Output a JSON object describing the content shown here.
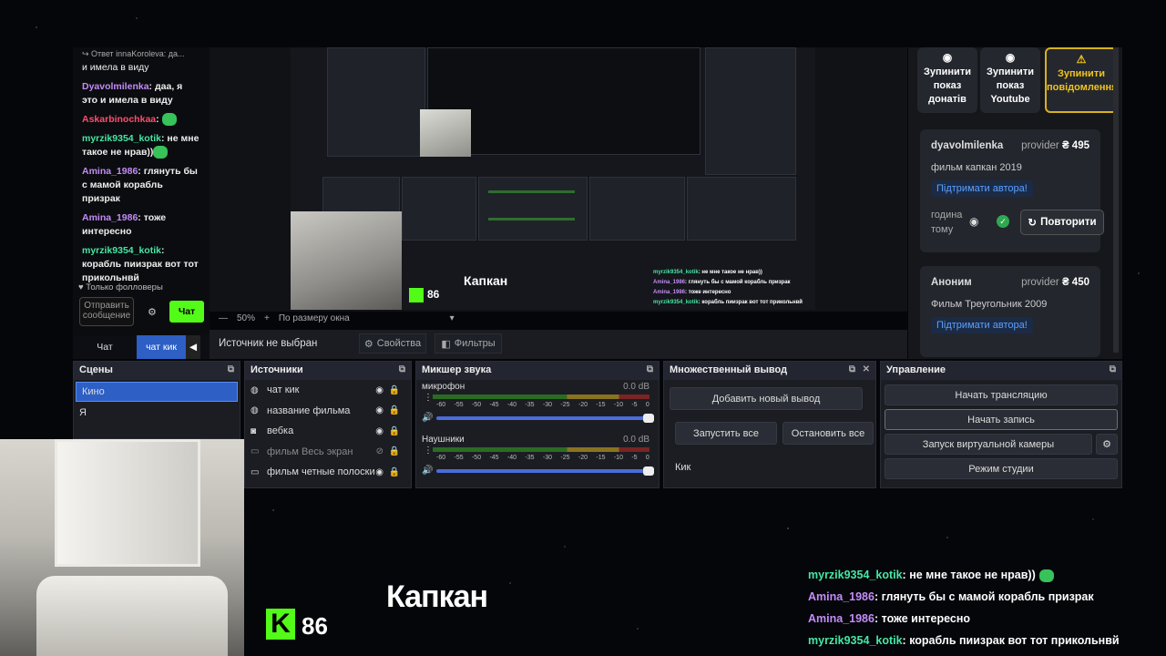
{
  "chat": {
    "reply_text": "Ответ innaKoroleva: да...",
    "reply_prev_text": "и имела в виду",
    "messages": [
      {
        "user": "Dyavolmilenka",
        "text": "даа, я это и имела в виду",
        "color": "#c38cf7"
      },
      {
        "user": "Askarbinochkaa",
        "text": "",
        "color": "#ff4d6d"
      },
      {
        "user": "myrzik9354_kotik",
        "text": "не мне такое не нрав))",
        "color": "#46e6a5"
      },
      {
        "user": "Amina_1986",
        "text": "глянуть бы с мамой корабль призрак",
        "color": "#c38cf7"
      },
      {
        "user": "Amina_1986",
        "text": "тоже интересно",
        "color": "#c38cf7"
      },
      {
        "user": "myrzik9354_kotik",
        "text": "корабль пиизрак вот тот прикольнвй",
        "color": "#46e6a5"
      }
    ],
    "followers_only": "Только фолловеры",
    "input_placeholder": "Отправить сообщение",
    "send_label": "Чат"
  },
  "left_tabs": {
    "chat": "Чат",
    "kick": "чат кик"
  },
  "preview": {
    "zoom": "50%",
    "zoom_mode": "По размеру окна",
    "source_status": "Источник не выбран",
    "properties": "Свойства",
    "filters": "Фильтры"
  },
  "donate_panel": {
    "buttons": [
      {
        "label": "Зупинити показ донатів",
        "icon": "stop-icon"
      },
      {
        "label": "Зупинити показ Youtube",
        "icon": "stop-icon"
      },
      {
        "label": "Зупинити повідомлення",
        "icon": "warning-icon"
      }
    ],
    "cards": [
      {
        "name": "dyavolmilenka",
        "provider": "provider",
        "amount": "₴ 495",
        "film": "фильм капкан 2019",
        "support": "Підтримати автора!",
        "time": "година тому",
        "retry": "Повторити"
      },
      {
        "name": "Аноним",
        "provider": "provider",
        "amount": "₴ 450",
        "film": "Фильм Треугольник 2009",
        "support": "Підтримати автора!"
      }
    ]
  },
  "scenes": {
    "title": "Сцены",
    "items": [
      "Кино",
      "Я"
    ]
  },
  "sources": {
    "title": "Источники",
    "items": [
      {
        "name": "чат кик",
        "icon": "globe-icon",
        "hidden": false
      },
      {
        "name": "название фильма",
        "icon": "globe-icon",
        "hidden": false
      },
      {
        "name": "вебка",
        "icon": "camera-icon",
        "hidden": false
      },
      {
        "name": "фильм Весь экран",
        "icon": "window-icon",
        "hidden": true
      },
      {
        "name": "фильм четные полоски",
        "icon": "window-icon",
        "hidden": false
      }
    ]
  },
  "mixer": {
    "title": "Микшер звука",
    "channels": [
      {
        "name": "микрофон",
        "db": "0.0 dB",
        "level": 1.0
      },
      {
        "name": "Наушники",
        "db": "0.0 dB",
        "level": 1.0
      }
    ],
    "scale": [
      "-60",
      "-55",
      "-50",
      "-45",
      "-40",
      "-35",
      "-30",
      "-25",
      "-20",
      "-15",
      "-10",
      "-5",
      "0"
    ]
  },
  "multi_output": {
    "title": "Множественный вывод",
    "add_label": "Добавить новый вывод",
    "start_all": "Запустить все",
    "stop_all": "Остановить все",
    "group": "Кик"
  },
  "controls": {
    "title": "Управление",
    "start_stream": "Начать трансляцию",
    "start_record": "Начать запись",
    "virtual_cam": "Запуск виртуальной камеры",
    "studio_mode": "Режим студии"
  },
  "overlay": {
    "kick_count": "86",
    "movie_title": "Капкан",
    "messages": [
      {
        "user": "myrzik9354_kotik",
        "text": "не мне такое не нрав))",
        "color": "#46e6a5"
      },
      {
        "user": "Amina_1986",
        "text": "глянуть бы с мамой корабль призрак",
        "color": "#c38cf7"
      },
      {
        "user": "Amina_1986",
        "text": "тоже интересно",
        "color": "#c38cf7"
      },
      {
        "user": "myrzik9354_kotik",
        "text": "корабль пиизрак вот тот прикольнвй",
        "color": "#46e6a5"
      }
    ]
  }
}
